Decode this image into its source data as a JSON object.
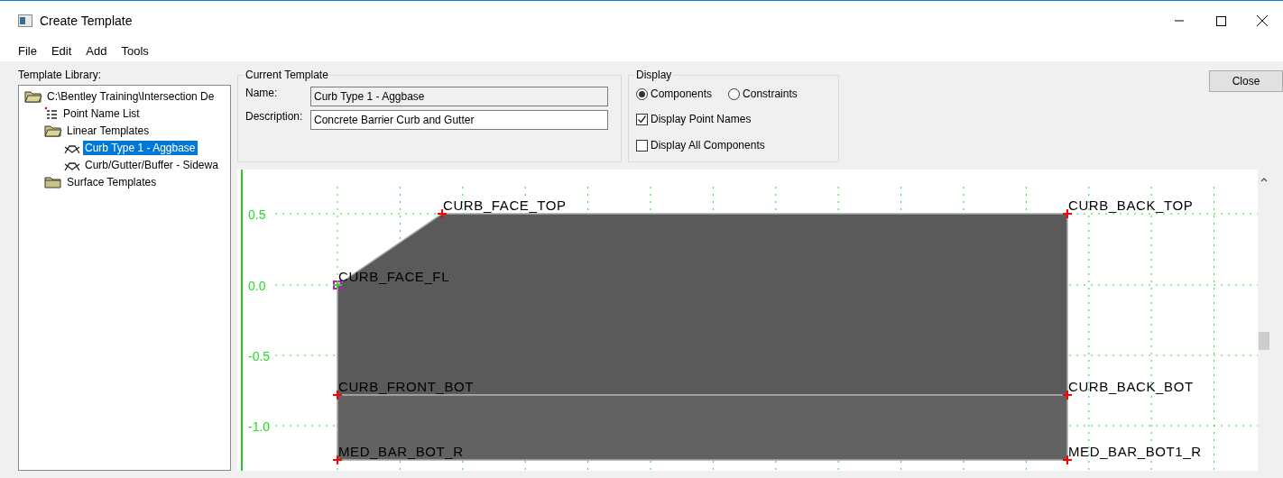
{
  "window": {
    "title": "Create Template"
  },
  "menu": [
    "File",
    "Edit",
    "Add",
    "Tools"
  ],
  "library": {
    "label": "Template Library:",
    "tree": [
      {
        "label": "C:\\Bentley Training\\Intersection De",
        "kind": "folder",
        "expanded": true,
        "selected": false,
        "children": [
          {
            "label": "Point Name List",
            "kind": "list",
            "selected": false
          },
          {
            "label": "Linear Templates",
            "kind": "folder",
            "expanded": true,
            "selected": false,
            "children": [
              {
                "label": "Curb Type 1 - Aggbase",
                "kind": "template",
                "selected": true
              },
              {
                "label": "Curb/Gutter/Buffer - Sidewa",
                "kind": "template",
                "selected": false
              }
            ]
          },
          {
            "label": "Surface Templates",
            "kind": "folder",
            "expanded": false,
            "selected": false
          }
        ]
      }
    ]
  },
  "current_template": {
    "title": "Current Template",
    "fields": [
      {
        "label": "Name:",
        "value": "Curb Type 1 - Aggbase",
        "disabled": true
      },
      {
        "label": "Description:",
        "value": "Concrete Barrier Curb and Gutter",
        "disabled": false
      }
    ]
  },
  "display": {
    "title": "Display",
    "radios": [
      {
        "label": "Components",
        "selected": true
      },
      {
        "label": "Constraints",
        "selected": false
      }
    ],
    "checkboxes": [
      {
        "label": "Display Point Names",
        "checked": true
      },
      {
        "label": "Display All Components",
        "checked": false
      }
    ]
  },
  "buttons": [
    "Close"
  ],
  "canvas": {
    "y_labels": [
      "0.5",
      "0.0",
      "-0.5",
      "-1.0"
    ],
    "points": [
      {
        "name": "CURB_FACE_TOP",
        "selected": false
      },
      {
        "name": "CURB_BACK_TOP",
        "selected": false
      },
      {
        "name": "CURB_FACE_FL",
        "selected": true
      },
      {
        "name": "CURB_FRONT_BOT",
        "selected": false
      },
      {
        "name": "CURB_BACK_BOT",
        "selected": false
      },
      {
        "name": "MED_BAR_BOT_R",
        "selected": false
      },
      {
        "name": "MED_BAR_BOT1_R",
        "selected": false
      }
    ]
  }
}
